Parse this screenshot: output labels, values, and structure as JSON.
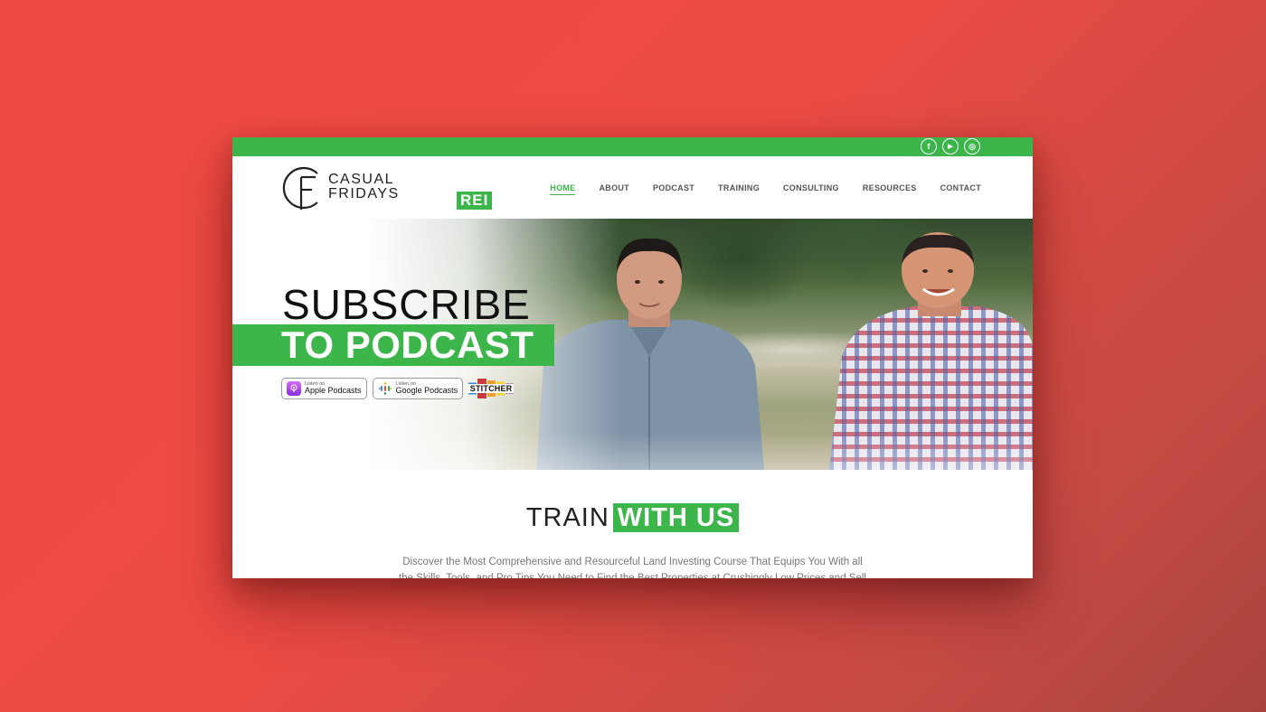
{
  "social": {
    "facebook": "f",
    "youtube": "▶",
    "instagram": "◎"
  },
  "logo": {
    "line1": "CASUAL",
    "line2": "FRIDAYS",
    "badge": "REI"
  },
  "nav": [
    {
      "label": "HOME",
      "active": true
    },
    {
      "label": "ABOUT",
      "active": false
    },
    {
      "label": "PODCAST",
      "active": false
    },
    {
      "label": "TRAINING",
      "active": false
    },
    {
      "label": "CONSULTING",
      "active": false
    },
    {
      "label": "RESOURCES",
      "active": false
    },
    {
      "label": "CONTACT",
      "active": false
    }
  ],
  "hero": {
    "line1": "SUBSCRIBE",
    "line2": "TO PODCAST",
    "apple": {
      "small": "Listen on",
      "big": "Apple Podcasts"
    },
    "google": {
      "small": "Listen on",
      "big": "Google Podcasts"
    },
    "stitcher": "STITCHER"
  },
  "train": {
    "light": "TRAIN",
    "bold": "WITH US",
    "description": "Discover the Most Comprehensive and Resourceful Land Investing Course That Equips You With all the Skills, Tools, and Pro Tips You Need to Find the Best Properties at Crushingly Low Prices and Sell"
  },
  "colors": {
    "accent": "#3cb54a",
    "background": "#ef4a42"
  }
}
